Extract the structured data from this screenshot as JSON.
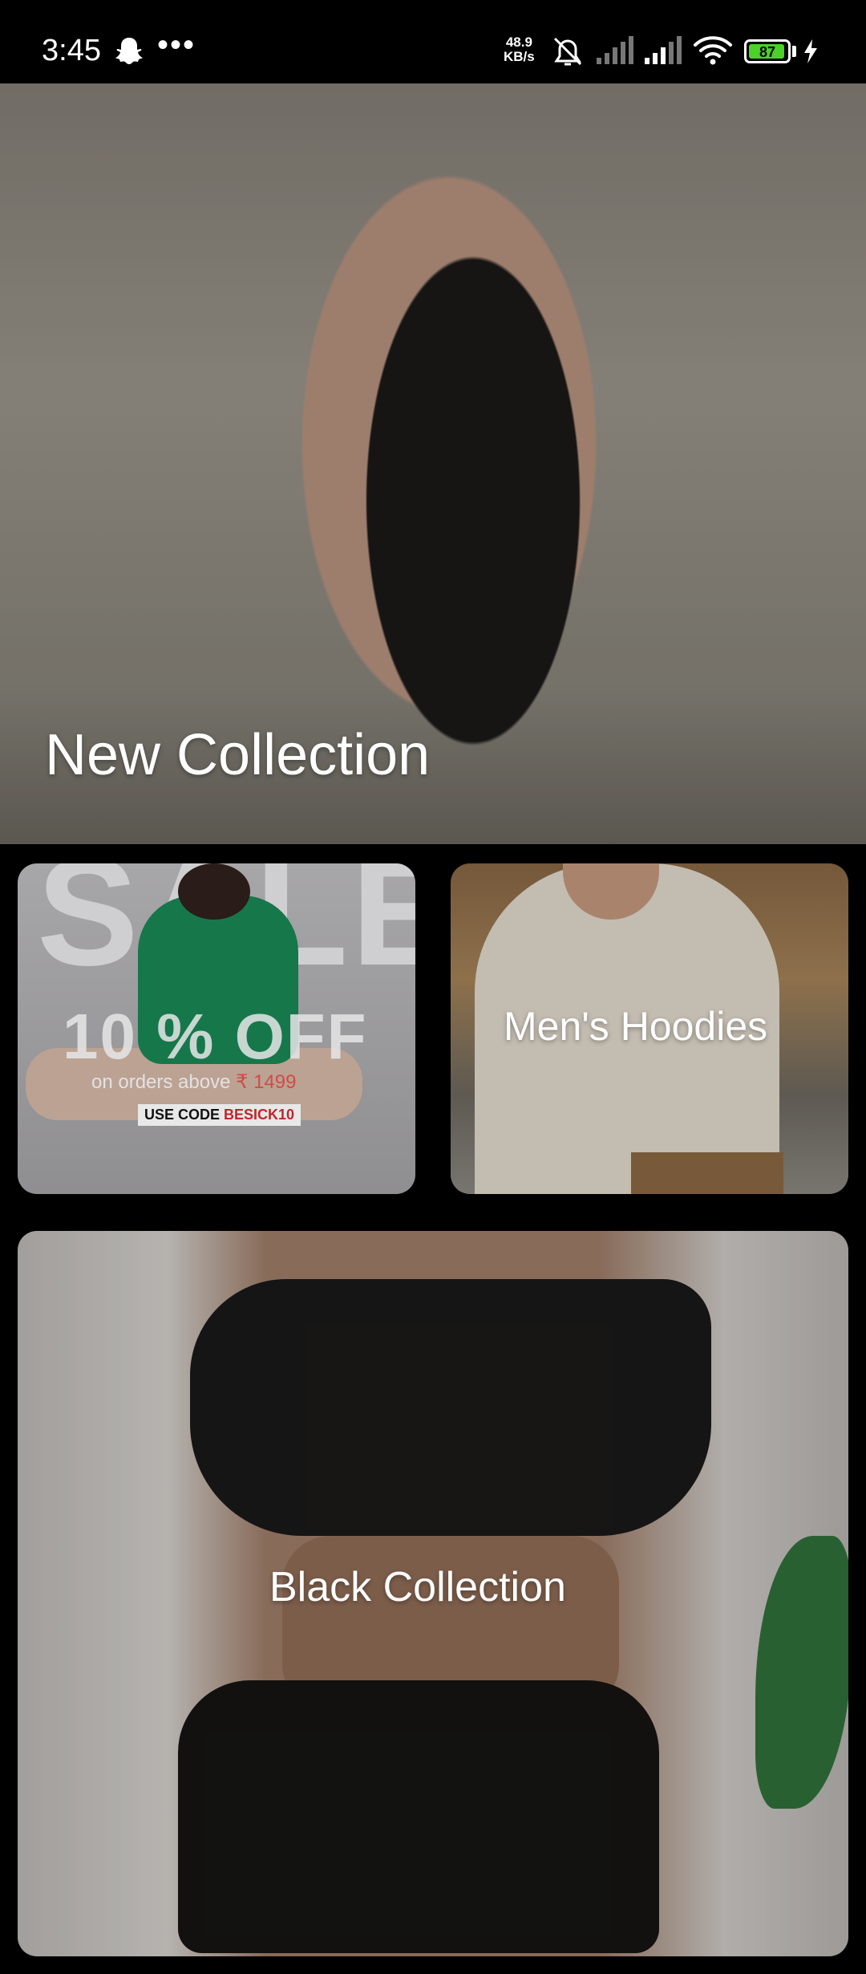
{
  "status_bar": {
    "time": "3:45",
    "more": "•••",
    "net_speed_value": "48.9",
    "net_speed_unit": "KB/s",
    "battery_level": "87",
    "icons": [
      "snapchat-ghost-icon",
      "alarm-off-icon",
      "signal-icon",
      "signal-icon",
      "wifi-icon",
      "battery-icon",
      "charging-bolt-icon"
    ],
    "battery_color": "#4bd12a"
  },
  "cards": {
    "hero_title": "New Collection",
    "sale": {
      "big_text": "SALE",
      "offer": "10 % OFF",
      "min_prefix": "on orders above ",
      "min_amount": "₹ 1499",
      "code_prefix": "USE CODE ",
      "code": "BESICK10"
    },
    "hoodies_title": "Men's Hoodies",
    "black_title": "Black Collection"
  }
}
